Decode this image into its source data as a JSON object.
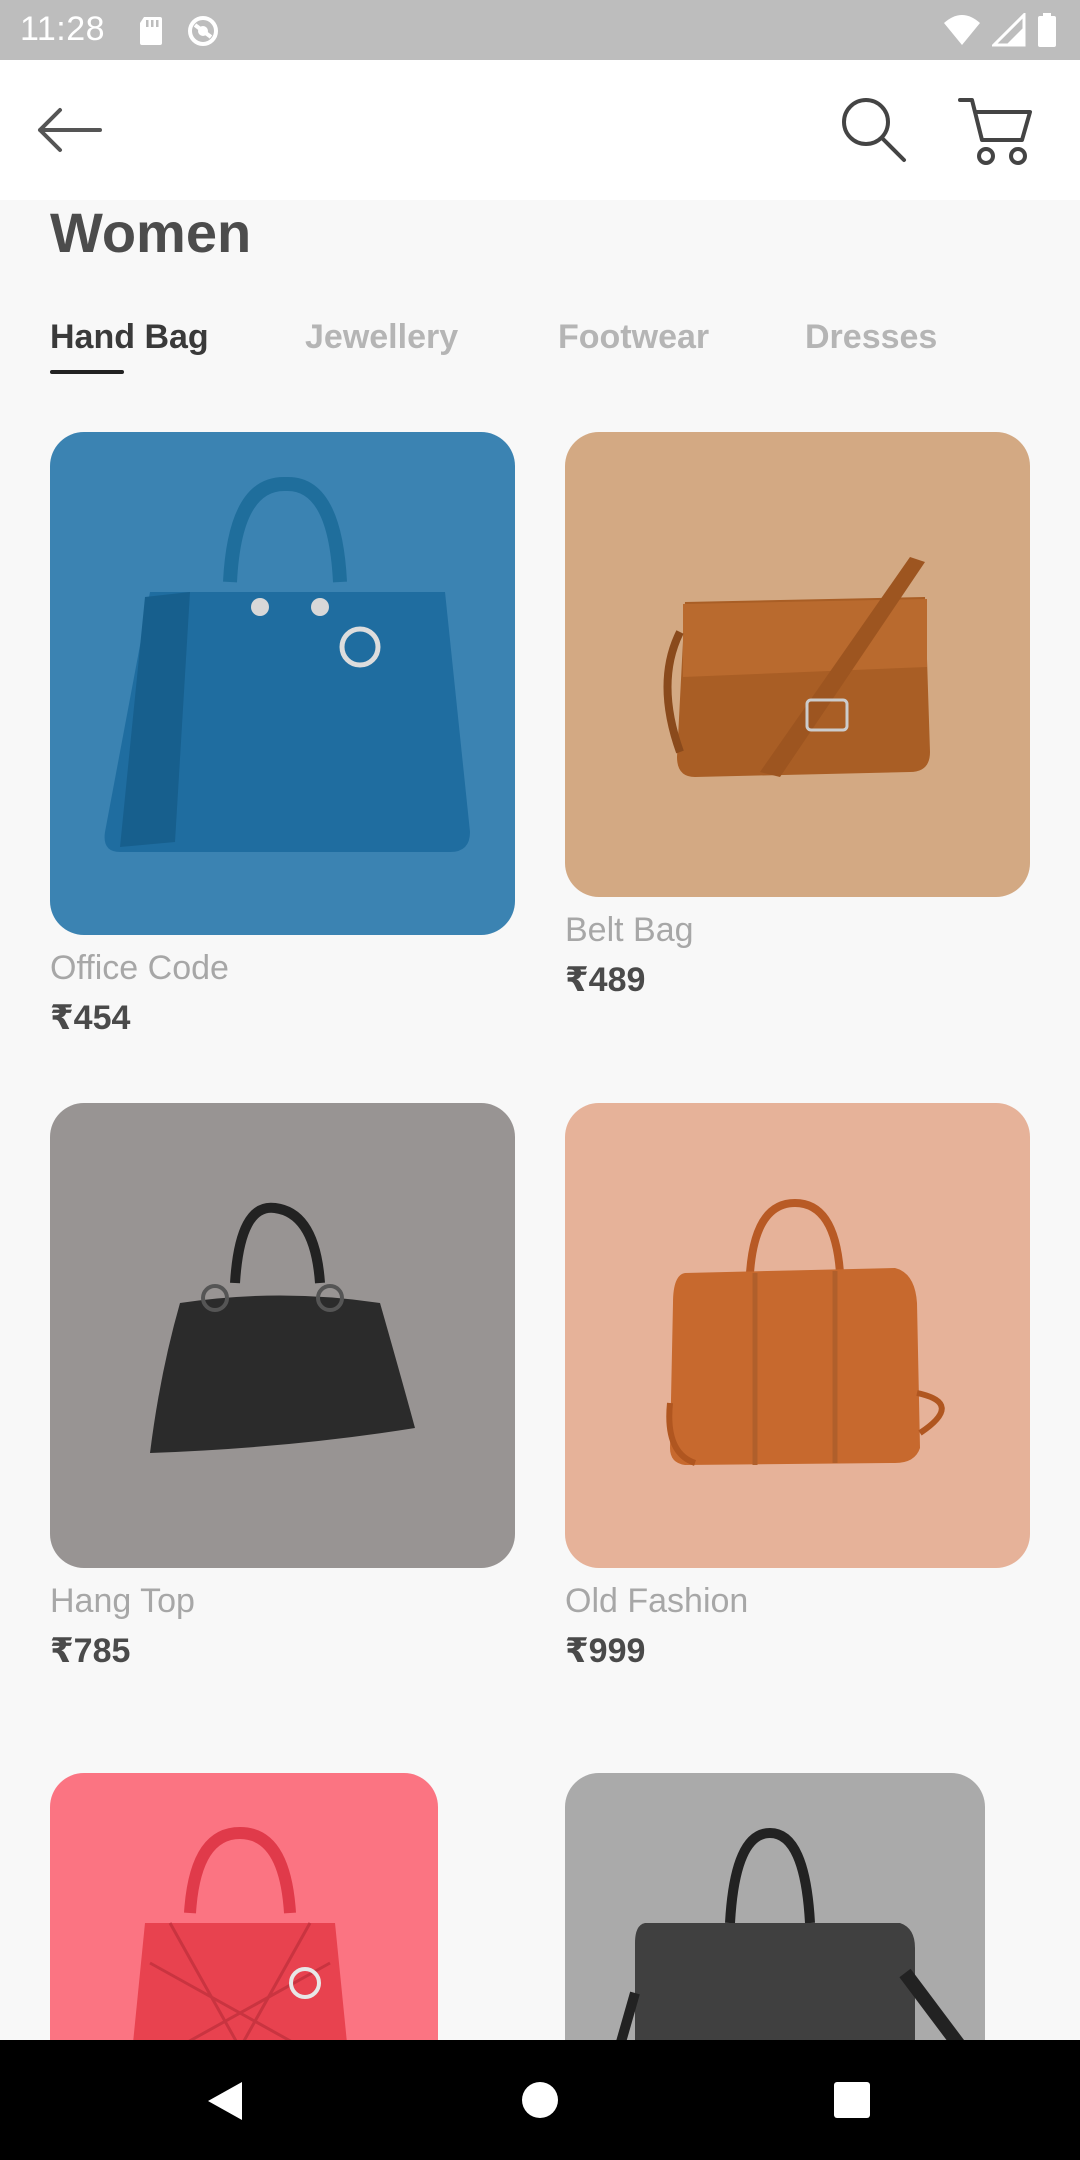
{
  "status_bar": {
    "time": "11:28",
    "icons_left": [
      "sd-card-icon",
      "no-disturb-icon"
    ],
    "icons_right": [
      "wifi-icon",
      "signal-icon",
      "battery-icon"
    ]
  },
  "app_bar": {
    "icons": [
      "back-arrow-icon",
      "search-icon",
      "cart-icon"
    ]
  },
  "page": {
    "title": "Women"
  },
  "tabs": [
    {
      "label": "Hand Bag",
      "active": true
    },
    {
      "label": "Jewellery",
      "active": false
    },
    {
      "label": "Footwear",
      "active": false
    },
    {
      "label": "Dresses",
      "active": false
    }
  ],
  "products": [
    {
      "name": "Office Code",
      "price": "₹454",
      "color": "#3b83b2"
    },
    {
      "name": "Belt Bag",
      "price": "₹489",
      "color": "#d3a983"
    },
    {
      "name": "Hang Top",
      "price": "₹785",
      "color": "#989493"
    },
    {
      "name": "Old Fashion",
      "price": "₹999",
      "color": "#e6b299"
    },
    {
      "name": "",
      "price": "",
      "color": "#fb7482"
    },
    {
      "name": "",
      "price": "",
      "color": "#aaaaaa"
    }
  ],
  "nav_bar": {
    "icons": [
      "nav-back-icon",
      "nav-home-icon",
      "nav-recents-icon"
    ]
  }
}
